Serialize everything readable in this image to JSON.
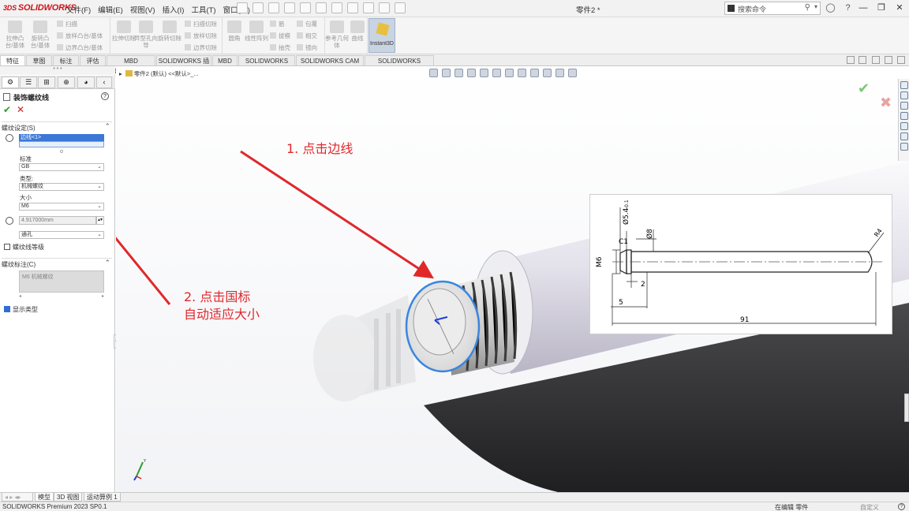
{
  "app": {
    "logo_text": "SOLIDWORKS",
    "logo_prefix": "3DS",
    "document_title": "零件2 *"
  },
  "menu": [
    "文件(F)",
    "编辑(E)",
    "视图(V)",
    "插入(I)",
    "工具(T)",
    "窗口(W)"
  ],
  "search": {
    "placeholder": "搜索命令"
  },
  "command_manager": {
    "features": {
      "extrude_boss": "拉伸凸台/基体",
      "revolve_boss": "旋转凸台/基体",
      "sweep": "扫描",
      "loft_boss": "放样凸台/基体",
      "boundary_boss": "边界凸台/基体",
      "extrude_cut": "拉伸切除",
      "hole_wizard": "异型孔向导",
      "revolve_cut": "旋转切除",
      "swept_cut": "扫描切除",
      "lofted_cut": "放样切除",
      "boundary_cut": "边界切除",
      "fillet": "圆角",
      "linear_pattern": "线性阵列",
      "rib": "筋",
      "draft": "拔模",
      "shell": "抽壳",
      "wrap": "包覆",
      "intersect": "相交",
      "mirror": "镜向",
      "reference_geometry": "参考几何体",
      "curves": "曲线",
      "instant3d": "Instant3D"
    }
  },
  "tabs": [
    "特征",
    "草图",
    "标注",
    "评估",
    "MBD Dimensions",
    "SOLIDWORKS 插件",
    "MBD",
    "SOLIDWORKS CAM",
    "SOLIDWORKS CAM TBM",
    "SOLIDWORKS Inspection"
  ],
  "property_manager": {
    "title": "装饰螺纹线",
    "thread_settings": {
      "header": "螺纹设定(S)",
      "edge_selection": "边线<1>",
      "standard_label": "标准",
      "standard_value": "GB",
      "type_label": "类型:",
      "type_value": "机械螺纹",
      "size_label": "大小",
      "size_value": "M6",
      "minor_diameter": "4.917000mm",
      "end_condition": "通孔",
      "thread_class_label": "螺纹线等级"
    },
    "thread_callout": {
      "header": "螺纹标注(C)",
      "text": "M6 机械螺纹"
    },
    "show_type_label": "显示类型"
  },
  "viewport": {
    "breadcrumb": "零件2 (默认) <<默认>_..."
  },
  "annotations": {
    "step1": "1. 点击边线",
    "step2_line1": "2. 点击国标",
    "step2_line2": "自动适应大小",
    "color": "#e0282b"
  },
  "drawing": {
    "dim_phi54": "Ø5.4",
    "dim_phi54_tol": "-0.1",
    "dim_phi8": "Ø8",
    "dim_c1": "C1",
    "dim_m6": "M6",
    "dim_2": "2",
    "dim_5": "5",
    "dim_91": "91",
    "dim_r4": "R4"
  },
  "bottom_tabs": [
    "模型",
    "3D 视图",
    "运动算例 1"
  ],
  "status": {
    "version": "SOLIDWORKS Premium 2023 SP0.1",
    "editing": "在编辑 零件",
    "custom": "自定义"
  }
}
